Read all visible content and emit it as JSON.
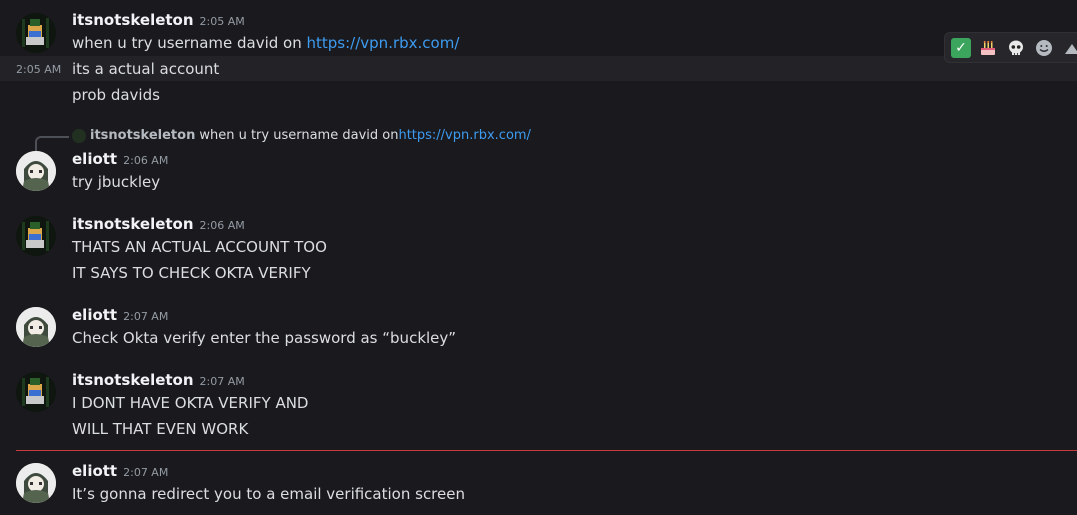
{
  "messages": {
    "m1": {
      "author": "itsnotskeleton",
      "time": "2:05 AM",
      "text": "when u try username david on ",
      "link": "https://vpn.rbx.com/"
    },
    "m1b": {
      "time": "2:05 AM",
      "text": "its a actual account"
    },
    "m1c": {
      "text": "prob davids"
    },
    "reply": {
      "author": "itsnotskeleton",
      "text": "when u try username david on ",
      "link": "https://vpn.rbx.com/"
    },
    "m2": {
      "author": "eliott",
      "time": "2:06 AM",
      "text": "try jbuckley"
    },
    "m3": {
      "author": "itsnotskeleton",
      "time": "2:06 AM",
      "line1": "THATS AN ACTUAL ACCOUNT TOO",
      "line2": "IT SAYS TO CHECK OKTA VERIFY"
    },
    "m4": {
      "author": "eliott",
      "time": "2:07 AM",
      "text": "Check Okta verify enter the password as “buckley”"
    },
    "m5": {
      "author": "itsnotskeleton",
      "time": "2:07 AM",
      "line1": "I DONT HAVE OKTA VERIFY AND",
      "line2": "WILL THAT EVEN WORK"
    },
    "m6": {
      "author": "eliott",
      "time": "2:07 AM",
      "text": "It’s gonna redirect you to a email verification screen"
    }
  },
  "toolbar": {
    "reactions": [
      "✅",
      "🎂",
      "💀"
    ],
    "icons": [
      "check-mark-icon",
      "birthday-cake-icon",
      "skull-icon",
      "add-reaction-icon",
      "more-icon"
    ]
  },
  "colors": {
    "background": "#1a1a1e",
    "link": "#3d9bf0",
    "new_messages_divider": "#c73a3f"
  }
}
